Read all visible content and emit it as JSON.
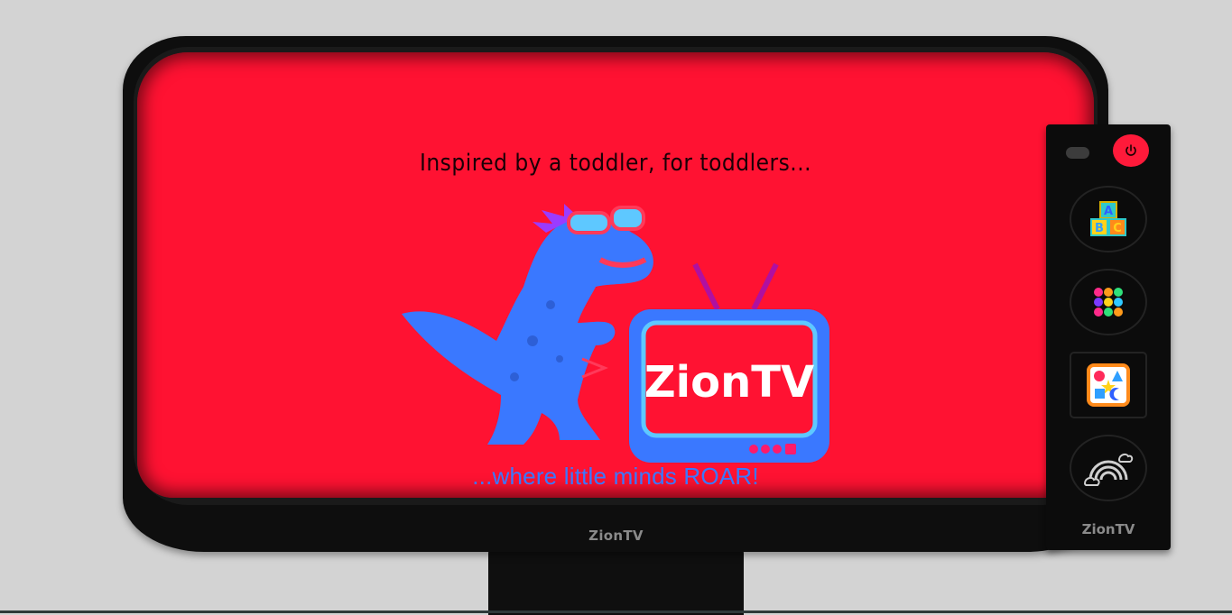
{
  "tv": {
    "brand": "ZionTV",
    "screen": {
      "tagline": "Inspired by a toddler, for toddlers...",
      "logo_text": "ZionTV",
      "slogan": "...where little minds ROAR!"
    }
  },
  "remote": {
    "brand": "ZionTV",
    "buttons": [
      {
        "icon": "power-icon"
      },
      {
        "icon": "abc-blocks-icon"
      },
      {
        "icon": "numbers-icon"
      },
      {
        "icon": "shapes-icon"
      },
      {
        "icon": "rainbow-icon"
      }
    ]
  },
  "colors": {
    "screen": "#ff1232",
    "dino": "#3a78ff",
    "power": "#ff1a3a"
  }
}
